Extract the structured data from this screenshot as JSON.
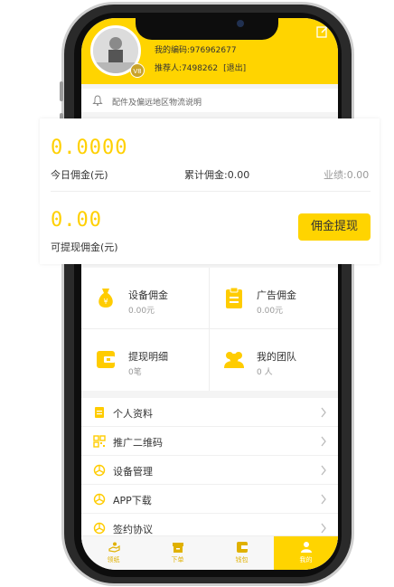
{
  "header": {
    "member_code": "我的编码:976962677",
    "referrer": "推荐人:7498262",
    "logout": "[退出]",
    "vip_badge": "V8"
  },
  "notice": {
    "text": "配件及偏远地区物流说明"
  },
  "commission_card": {
    "today_value": "0.0000",
    "today_label": "今日佣金(元)",
    "total_label": "累计佣金:0.00",
    "performance_label": "业绩:0.00",
    "withdrawable_value": "0.00",
    "withdrawable_label": "可提现佣金(元)",
    "withdraw_button": "佣金提现"
  },
  "grid": [
    {
      "title": "设备佣金",
      "value": "0.00元",
      "icon": "money-bag-icon"
    },
    {
      "title": "广告佣金",
      "value": "0.00元",
      "icon": "clipboard-icon"
    },
    {
      "title": "提现明细",
      "value": "0笔",
      "icon": "wallet-icon"
    },
    {
      "title": "我的团队",
      "value": "0 人",
      "icon": "team-icon"
    }
  ],
  "menu": [
    {
      "label": "个人资料",
      "icon": "profile-doc-icon"
    },
    {
      "label": "推广二维码",
      "icon": "qr-code-icon"
    },
    {
      "label": "设备管理",
      "icon": "device-gear-icon"
    },
    {
      "label": "APP下载",
      "icon": "download-icon"
    },
    {
      "label": "签约协议",
      "icon": "agreement-icon"
    }
  ],
  "tabbar": [
    {
      "label": "领纸",
      "icon": "hand-icon"
    },
    {
      "label": "下单",
      "icon": "box-icon"
    },
    {
      "label": "钱包",
      "icon": "wallet-icon"
    },
    {
      "label": "我的",
      "icon": "user-icon"
    }
  ],
  "colors": {
    "accent": "#ffd400",
    "number": "#ffd000"
  }
}
